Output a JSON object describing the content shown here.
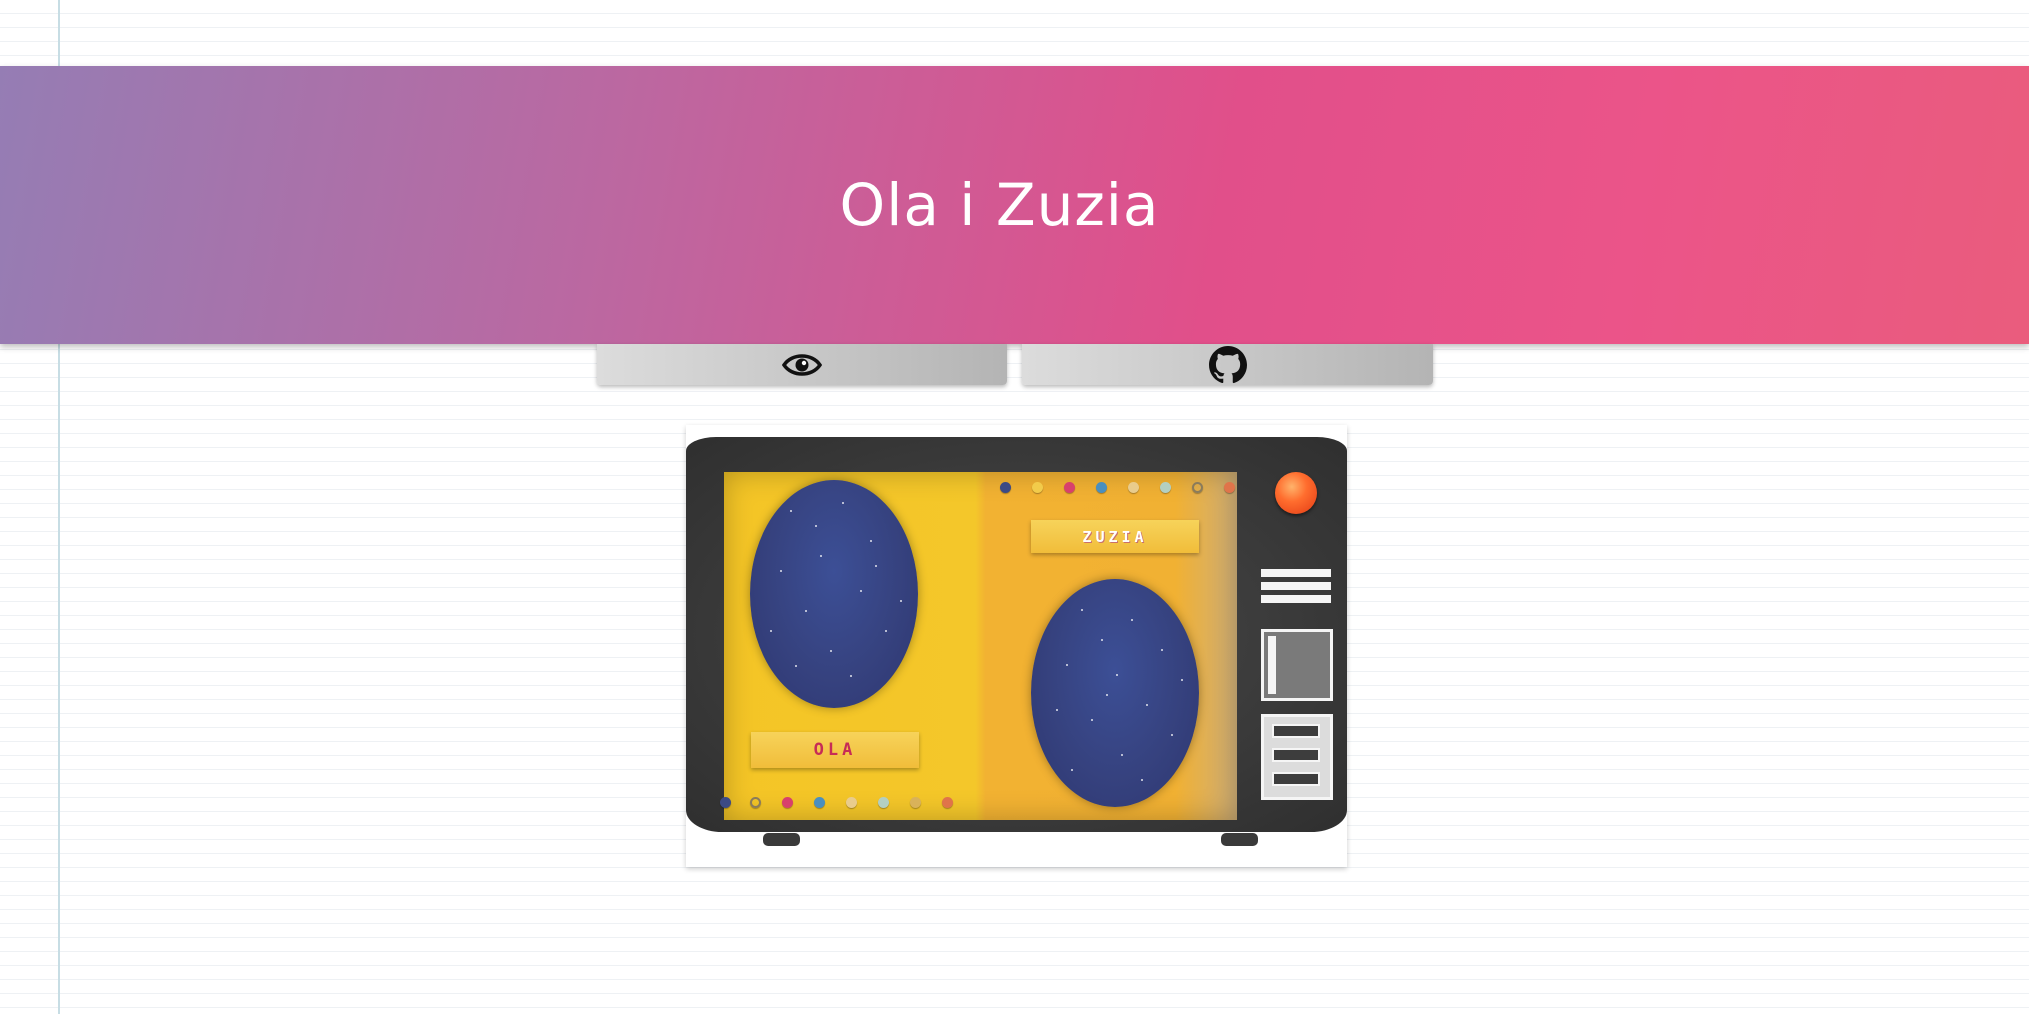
{
  "header": {
    "title": "Ola i Zuzia"
  },
  "buttons": {
    "demo_icon": "eye-icon",
    "code_icon": "github-icon"
  },
  "preview": {
    "left_name": "OLA",
    "right_name": "ZUZIA"
  },
  "colors": {
    "gradient_start": "#957db4",
    "gradient_end": "#ea5c7d",
    "screen_yellow": "#f4c526",
    "screen_orange": "#f1b133",
    "orb_blue": "#36427f",
    "power_red": "#ff6d2e"
  }
}
